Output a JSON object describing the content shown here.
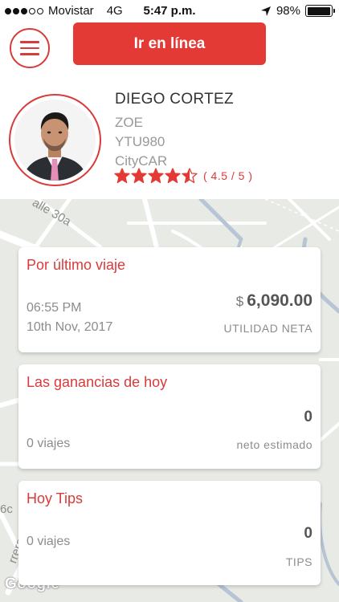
{
  "status_bar": {
    "carrier": "Movistar",
    "network": "4G",
    "time": "5:47 p.m.",
    "battery": "98%",
    "battery_level": 0.98
  },
  "header": {
    "menu_icon": "hamburger-menu-icon",
    "online_button": "Ir en línea"
  },
  "driver": {
    "name": "DIEGO CORTEZ",
    "model": "ZOE",
    "plate": "YTU980",
    "service": "CityCAR",
    "rating_value": 4.5,
    "rating_max": 5,
    "rating_text": "( 4.5 / 5 )"
  },
  "map": {
    "labels": [
      "alle 30a",
      "6c",
      "rrera 3a"
    ],
    "attribution": "Google"
  },
  "cards": {
    "last_trip": {
      "title": "Por último viaje",
      "time": "06:55 PM",
      "date": "10th Nov, 2017",
      "currency": "$",
      "amount": "6,090.00",
      "amount_label": "UTILIDAD NETA"
    },
    "today_earnings": {
      "title": "Las ganancias de hoy",
      "value": "0",
      "trips": "0 viajes",
      "value_label": "neto estimado"
    },
    "today_tips": {
      "title": "Hoy Tips",
      "value": "0",
      "trips": "0 viajes",
      "value_label": "TIPS"
    }
  },
  "colors": {
    "accent": "#e33a36",
    "text_muted": "#8c8c8c"
  }
}
